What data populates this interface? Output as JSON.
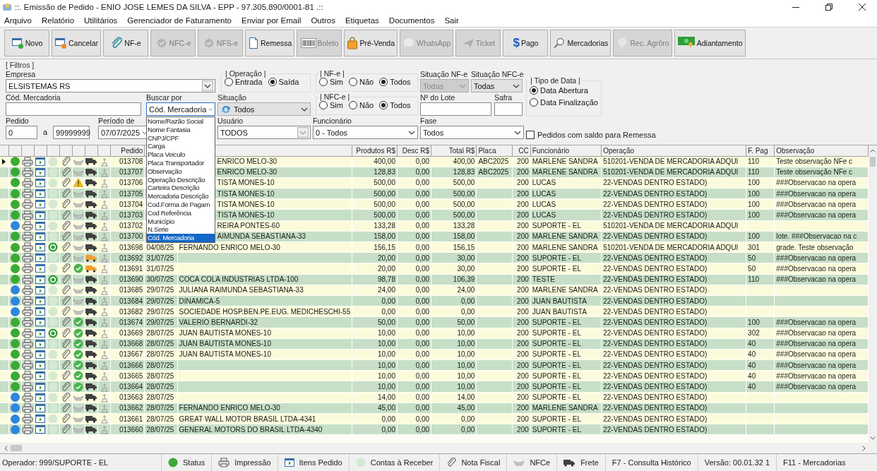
{
  "window": {
    "title": "::. Emissão de Pedido - ENIO JOSE LEMES DA SILVA - EPP - 97.305.890/0001-81 .::"
  },
  "menu": [
    "Arquivo",
    "Relatório",
    "Utilitários",
    "Gerenciador de Faturamento",
    "Enviar por Email",
    "Outros",
    "Etiquetas",
    "Documentos",
    "Sair"
  ],
  "toolbar": [
    {
      "label": "Novo",
      "disabled": false
    },
    {
      "label": "Cancelar",
      "disabled": false
    },
    {
      "label": "NF-e",
      "disabled": false
    },
    {
      "label": "NFC-e",
      "disabled": true
    },
    {
      "label": "NFS-e",
      "disabled": true
    },
    {
      "label": "Remessa",
      "disabled": false
    },
    {
      "label": "Boleto",
      "disabled": true
    },
    {
      "label": "Pré-Venda",
      "disabled": false
    },
    {
      "label": "WhatsApp",
      "disabled": true
    },
    {
      "label": "Ticket",
      "disabled": true
    },
    {
      "label": "Pago",
      "glyph": "$",
      "disabled": false
    },
    {
      "label": "Mercadorias",
      "disabled": false
    },
    {
      "label": "Rec. Agrôro",
      "disabled": true
    },
    {
      "label": "Adiantamento",
      "disabled": false
    }
  ],
  "filters": {
    "title": "[ Filtros ]",
    "empresa": {
      "label": "Empresa",
      "value": "ELSISTEMAS RS",
      "kind": "combo"
    },
    "operacao": {
      "title": "| Operação |",
      "options": [
        {
          "label": "Entrada",
          "selected": false
        },
        {
          "label": "Saída",
          "selected": true
        }
      ]
    },
    "nfe": {
      "title": "| NF-e |",
      "options": [
        {
          "label": "Sim",
          "selected": false
        },
        {
          "label": "Não",
          "selected": false
        },
        {
          "label": "Todos",
          "selected": true
        }
      ]
    },
    "situacao_nfe": {
      "label": "Situação NF-e",
      "value": "Todas",
      "kind": "dropdown",
      "disabled": true
    },
    "situacao_nfce": {
      "label": "Situação NFC-e",
      "value": "Todas",
      "kind": "dropdown",
      "disabled": false
    },
    "tipo_data": {
      "title": "| Tipo de Data |",
      "options": [
        {
          "label": "Data Abertura",
          "selected": true
        },
        {
          "label": "Data Finalização",
          "selected": false
        }
      ]
    },
    "cod_mercadoria": {
      "label": "Cód. Mercadoria"
    },
    "buscar_por": {
      "label": "Buscar por",
      "value": "Cód. Mercadoria",
      "kind": "combo",
      "expanded": true,
      "options": [
        {
          "label": "Nome/Razão Social",
          "selected": false
        },
        {
          "label": "Nome Fantasia",
          "selected": false
        },
        {
          "label": "CNPJ/CPF",
          "selected": false
        },
        {
          "label": "Carga",
          "selected": false
        },
        {
          "label": "Placa Veiculo",
          "selected": false
        },
        {
          "label": "Placa Transportador",
          "selected": false
        },
        {
          "label": "Observação",
          "selected": false
        },
        {
          "label": "Operação Descrição",
          "selected": false
        },
        {
          "label": "Carteira Descrição",
          "selected": false
        },
        {
          "label": "Mercadoria Descrição",
          "selected": false
        },
        {
          "label": "Cod.Forma de Pagam",
          "selected": false
        },
        {
          "label": "Cod Referência",
          "selected": false
        },
        {
          "label": "Município",
          "selected": false
        },
        {
          "label": "N.Serie",
          "selected": false
        },
        {
          "label": "Cód. Mercadoria",
          "selected": true
        }
      ]
    },
    "situacao": {
      "label": "Situação",
      "value": "Todos",
      "kind": "dropdown"
    },
    "nfce": {
      "title": "| NFC-e |",
      "options": [
        {
          "label": "Sim",
          "selected": false
        },
        {
          "label": "Não",
          "selected": false
        },
        {
          "label": "Todos",
          "selected": true
        }
      ]
    },
    "lote": {
      "label": "Nº do Lote"
    },
    "safra": {
      "label": "Safra"
    },
    "pedido": {
      "label": "Pedido",
      "from": "0",
      "to_label": "a",
      "to": "99999999"
    },
    "periodo": {
      "label": "Período de",
      "value": "07/07/2025",
      "kind": "combo"
    },
    "usuario": {
      "label": "Usuário",
      "value": "TODOS",
      "kind": "combo"
    },
    "funcionario": {
      "label": "Funcionário",
      "value": "0 - Todos",
      "kind": "combo"
    },
    "fase": {
      "label": "Fase",
      "value": "Todos",
      "kind": "combo"
    },
    "saldo_remessa": {
      "label": "Pedidos com saldo para Remessa",
      "checked": false
    }
  },
  "table": {
    "columns": [
      "Pedido",
      "Produtos R$",
      "Desc R$",
      "Total R$",
      "Placa",
      "CC",
      "Funcionário",
      "Operação",
      "F. Pag",
      "Observação"
    ],
    "rows": [
      {
        "selected": true,
        "color": "#3aaa35",
        "paid": false,
        "nfce_ok": false,
        "warning": false,
        "frete_alert": false,
        "covered": true,
        "pedido": "013708",
        "cliente": "ENRICO MELO-30",
        "produtos": "400,00",
        "desc": "0,00",
        "total": "400,00",
        "placa": "ABC2025",
        "cc": "200",
        "funcionario": "MARLENE SANDRA",
        "operacao": "510201-VENDA DE MERCADORIA ADQUI",
        "fpag": "110",
        "obs": "Teste observação NFe c"
      },
      {
        "selected": false,
        "color": "#3aaa35",
        "paid": false,
        "nfce_ok": false,
        "warning": false,
        "frete_alert": false,
        "covered": true,
        "pedido": "013707",
        "cliente": "ENRICO MELO-30",
        "produtos": "128,83",
        "desc": "0,00",
        "total": "128,83",
        "placa": "ABC2025",
        "cc": "200",
        "funcionario": "MARLENE SANDRA",
        "operacao": "510201-VENDA DE MERCADORIA ADQUI",
        "fpag": "110",
        "obs": "Teste observação NFe c"
      },
      {
        "selected": false,
        "color": "#3aaa35",
        "paid": false,
        "nfce_ok": false,
        "warning": true,
        "frete_alert": false,
        "covered": true,
        "pedido": "013706",
        "cliente": "TISTA MONES-10",
        "produtos": "500,00",
        "desc": "0,00",
        "total": "500,00",
        "cc": "200",
        "funcionario": "LUCAS",
        "operacao": "22-VENDAS DENTRO ESTADO)",
        "fpag": "100",
        "obs": "###Observacao na opera"
      },
      {
        "selected": false,
        "color": "#3aaa35",
        "paid": false,
        "nfce_ok": false,
        "warning": false,
        "frete_alert": false,
        "covered": true,
        "pedido": "013705",
        "cliente": "TISTA MONES-10",
        "produtos": "500,00",
        "desc": "0,00",
        "total": "500,00",
        "cc": "200",
        "funcionario": "LUCAS",
        "operacao": "22-VENDAS DENTRO ESTADO)",
        "fpag": "100",
        "obs": "###Observacao na opera"
      },
      {
        "selected": false,
        "color": "#3aaa35",
        "paid": false,
        "nfce_ok": false,
        "warning": false,
        "frete_alert": false,
        "covered": true,
        "pedido": "013704",
        "cliente": "TISTA MONES-10",
        "produtos": "500,00",
        "desc": "0,00",
        "total": "500,00",
        "cc": "200",
        "funcionario": "LUCAS",
        "operacao": "22-VENDAS DENTRO ESTADO)",
        "fpag": "100",
        "obs": "###Observacao na opera"
      },
      {
        "selected": false,
        "color": "#3aaa35",
        "paid": false,
        "nfce_ok": false,
        "warning": false,
        "frete_alert": false,
        "covered": true,
        "pedido": "013703",
        "cliente": "TISTA MONES-10",
        "produtos": "500,00",
        "desc": "0,00",
        "total": "500,00",
        "cc": "200",
        "funcionario": "LUCAS",
        "operacao": "22-VENDAS DENTRO ESTADO)",
        "fpag": "100",
        "obs": "###Observacao na opera"
      },
      {
        "selected": false,
        "color": "#2e86de",
        "paid": false,
        "nfce_ok": false,
        "warning": false,
        "frete_alert": false,
        "covered": true,
        "pedido": "013702",
        "cliente": "REIRA PONTES-60",
        "produtos": "133,28",
        "desc": "0,00",
        "total": "133,28",
        "cc": "200",
        "funcionario": "SUPORTE - EL",
        "operacao": "510201-VENDA DE MERCADORIA ADQUI"
      },
      {
        "selected": false,
        "color": "#3aaa35",
        "paid": false,
        "nfce_ok": false,
        "warning": false,
        "frete_alert": false,
        "covered": true,
        "pedido": "013700",
        "cliente": "AIMUNDA SEBASTIANA-33",
        "produtos": "158,00",
        "desc": "0,00",
        "total": "158,00",
        "cc": "200",
        "funcionario": "MARLENE SANDRA",
        "operacao": "22-VENDAS DENTRO ESTADO)",
        "fpag": "100",
        "obs": "lote. ###Observacao na c"
      },
      {
        "selected": false,
        "color": "#3aaa35",
        "paid": true,
        "nfce_ok": false,
        "warning": false,
        "frete_alert": false,
        "covered": false,
        "pedido": "013698",
        "data": "04/08/25",
        "cliente": "FERNANDO ENRICO MELO-30",
        "produtos": "156,15",
        "desc": "0,00",
        "total": "156,15",
        "cc": "200",
        "funcionario": "MARLENE SANDRA",
        "operacao": "510201-VENDA DE MERCADORIA ADQUI",
        "fpag": "301",
        "obs": "grade. Teste observação"
      },
      {
        "selected": false,
        "color": "#3aaa35",
        "paid": false,
        "nfce_ok": false,
        "warning": false,
        "frete_alert": true,
        "covered": false,
        "pedido": "013692",
        "data": "31/07/25",
        "produtos": "20,00",
        "desc": "0,00",
        "total": "30,00",
        "cc": "200",
        "funcionario": "SUPORTE - EL",
        "operacao": "22-VENDAS DENTRO ESTADO)",
        "fpag": "50",
        "obs": "###Observacao na opera"
      },
      {
        "selected": false,
        "color": "#3aaa35",
        "paid": false,
        "nfce_ok": true,
        "warning": false,
        "frete_alert": true,
        "covered": false,
        "pedido": "013691",
        "data": "31/07/25",
        "produtos": "20,00",
        "desc": "0,00",
        "total": "30,00",
        "cc": "200",
        "funcionario": "SUPORTE - EL",
        "operacao": "22-VENDAS DENTRO ESTADO)",
        "fpag": "50",
        "obs": "###Observacao na opera"
      },
      {
        "selected": false,
        "color": "#3aaa35",
        "paid": true,
        "nfce_ok": false,
        "warning": false,
        "frete_alert": false,
        "covered": false,
        "pedido": "013690",
        "data": "30/07/25",
        "cliente": "COCA COLA INDUSTRIAS LTDA-100",
        "produtos": "98,78",
        "desc": "0,00",
        "total": "106,39",
        "cc": "200",
        "funcionario": "TESTE",
        "operacao": "22-VENDAS DENTRO ESTADO)",
        "fpag": "110",
        "obs": "###Observacao na opera"
      },
      {
        "selected": false,
        "color": "#2e86de",
        "paid": false,
        "nfce_ok": false,
        "warning": false,
        "frete_alert": false,
        "covered": false,
        "pedido": "013685",
        "data": "29/07/25",
        "cliente": "JULIANA RAIMUNDA SEBASTIANA-33",
        "produtos": "24,00",
        "desc": "0,00",
        "total": "24,00",
        "cc": "200",
        "funcionario": "MARLENE SANDRA",
        "operacao": "22-VENDAS DENTRO ESTADO)"
      },
      {
        "selected": false,
        "color": "#2e86de",
        "paid": false,
        "nfce_ok": false,
        "warning": false,
        "frete_alert": false,
        "covered": false,
        "pedido": "013684",
        "data": "29/07/25",
        "cliente": "DINAMICA-5",
        "produtos": "0,00",
        "desc": "0,00",
        "total": "0,00",
        "cc": "200",
        "funcionario": "JUAN BAUTISTA",
        "operacao": "22-VENDAS DENTRO ESTADO)"
      },
      {
        "selected": false,
        "color": "#2e86de",
        "paid": false,
        "nfce_ok": false,
        "warning": false,
        "frete_alert": false,
        "covered": false,
        "pedido": "013682",
        "data": "29/07/25",
        "cliente": "SOCIEDADE HOSP.BEN.PE.EUG. MEDICHESCHI-55",
        "produtos": "0,00",
        "desc": "0,00",
        "total": "0,00",
        "cc": "200",
        "funcionario": "JUAN BAUTISTA",
        "operacao": "22-VENDAS DENTRO ESTADO)"
      },
      {
        "selected": false,
        "color": "#3aaa35",
        "paid": false,
        "nfce_ok": true,
        "warning": false,
        "frete_alert": false,
        "covered": false,
        "pedido": "013674",
        "data": "29/07/25",
        "cliente": "VALERIO BERNARDI-32",
        "produtos": "50,00",
        "desc": "0,00",
        "total": "50,00",
        "cc": "200",
        "funcionario": "SUPORTE - EL",
        "operacao": "22-VENDAS DENTRO ESTADO)",
        "fpag": "100",
        "obs": "###Observacao na opera"
      },
      {
        "selected": false,
        "color": "#3aaa35",
        "paid": true,
        "nfce_ok": true,
        "warning": false,
        "frete_alert": false,
        "covered": false,
        "pedido": "013669",
        "data": "28/07/25",
        "cliente": "JUAN BAUTISTA MONES-10",
        "produtos": "10,00",
        "desc": "0,00",
        "total": "10,00",
        "cc": "200",
        "funcionario": "SUPORTE - EL",
        "operacao": "22-VENDAS DENTRO ESTADO)",
        "fpag": "302",
        "obs": "###Observacao na opera"
      },
      {
        "selected": false,
        "color": "#3aaa35",
        "paid": false,
        "nfce_ok": true,
        "warning": false,
        "frete_alert": false,
        "covered": false,
        "pedido": "013668",
        "data": "28/07/25",
        "cliente": "JUAN BAUTISTA MONES-10",
        "produtos": "10,00",
        "desc": "0,00",
        "total": "10,00",
        "cc": "200",
        "funcionario": "SUPORTE - EL",
        "operacao": "22-VENDAS DENTRO ESTADO)",
        "fpag": "40",
        "obs": "###Observacao na opera"
      },
      {
        "selected": false,
        "color": "#3aaa35",
        "paid": false,
        "nfce_ok": true,
        "warning": false,
        "frete_alert": false,
        "covered": false,
        "pedido": "013667",
        "data": "28/07/25",
        "cliente": "JUAN BAUTISTA MONES-10",
        "produtos": "10,00",
        "desc": "0,00",
        "total": "10,00",
        "cc": "200",
        "funcionario": "SUPORTE - EL",
        "operacao": "22-VENDAS DENTRO ESTADO)",
        "fpag": "40",
        "obs": "###Observacao na opera"
      },
      {
        "selected": false,
        "color": "#3aaa35",
        "paid": false,
        "nfce_ok": true,
        "warning": false,
        "frete_alert": false,
        "covered": false,
        "pedido": "013666",
        "data": "28/07/25",
        "produtos": "10,00",
        "desc": "0,00",
        "total": "10,00",
        "cc": "200",
        "funcionario": "SUPORTE - EL",
        "operacao": "22-VENDAS DENTRO ESTADO)",
        "fpag": "40",
        "obs": "###Observacao na opera"
      },
      {
        "selected": false,
        "color": "#3aaa35",
        "paid": false,
        "nfce_ok": true,
        "warning": false,
        "frete_alert": false,
        "covered": false,
        "pedido": "013665",
        "data": "28/07/25",
        "produtos": "10,00",
        "desc": "0,00",
        "total": "10,00",
        "cc": "200",
        "funcionario": "SUPORTE - EL",
        "operacao": "22-VENDAS DENTRO ESTADO)",
        "fpag": "40",
        "obs": "###Observacao na opera"
      },
      {
        "selected": false,
        "color": "#3aaa35",
        "paid": false,
        "nfce_ok": true,
        "warning": false,
        "frete_alert": false,
        "covered": false,
        "pedido": "013664",
        "data": "28/07/25",
        "produtos": "10,00",
        "desc": "0,00",
        "total": "10,00",
        "cc": "200",
        "funcionario": "SUPORTE - EL",
        "operacao": "22-VENDAS DENTRO ESTADO)",
        "fpag": "40",
        "obs": "###Observacao na opera"
      },
      {
        "selected": false,
        "color": "#2e86de",
        "paid": false,
        "nfce_ok": false,
        "warning": false,
        "frete_alert": false,
        "covered": false,
        "pedido": "013663",
        "data": "28/07/25",
        "produtos": "14,00",
        "desc": "0,00",
        "total": "14,00",
        "cc": "200",
        "funcionario": "SUPORTE - EL",
        "operacao": "22-VENDAS DENTRO ESTADO)"
      },
      {
        "selected": false,
        "color": "#2e86de",
        "paid": false,
        "nfce_ok": false,
        "warning": false,
        "frete_alert": false,
        "covered": false,
        "pedido": "013662",
        "data": "28/07/25",
        "cliente": "FERNANDO ENRICO MELO-30",
        "produtos": "45,00",
        "desc": "0,00",
        "total": "45,00",
        "cc": "200",
        "funcionario": "MARLENE SANDRA",
        "operacao": "22-VENDAS DENTRO ESTADO)"
      },
      {
        "selected": false,
        "color": "#2e86de",
        "paid": false,
        "nfce_ok": false,
        "warning": false,
        "frete_alert": false,
        "covered": false,
        "pedido": "013661",
        "data": "28/07/25",
        "cliente": "GREAT WALL MOTOR BRASIL LTDA-4341",
        "produtos": "0,00",
        "desc": "0,00",
        "total": "0,00",
        "cc": "200",
        "funcionario": "SUPORTE - EL",
        "operacao": "22-VENDAS DENTRO ESTADO)"
      },
      {
        "selected": false,
        "color": "#2e86de",
        "paid": false,
        "nfce_ok": false,
        "warning": false,
        "frete_alert": false,
        "covered": false,
        "pedido": "013660",
        "data": "28/07/25",
        "cliente": "GENERAL MOTORS DO BRASIL LTDA-4340",
        "produtos": "0,00",
        "desc": "0,00",
        "total": "0,00",
        "cc": "200",
        "funcionario": "SUPORTE - EL",
        "operacao": "22-VENDAS DENTRO ESTADO)"
      }
    ]
  },
  "status_bar": {
    "operator": "Operador: 999/SUPORTE - EL",
    "legend": [
      "Status",
      "Impressão",
      "Itens Pedido",
      "Contas à Receber",
      "Nota Fiscal",
      "NFCe",
      "Frete"
    ],
    "shortcuts": [
      "F7 - Consulta Histórico",
      "Versão: 00.01.32 1",
      "F11 - Mercadorias"
    ]
  }
}
